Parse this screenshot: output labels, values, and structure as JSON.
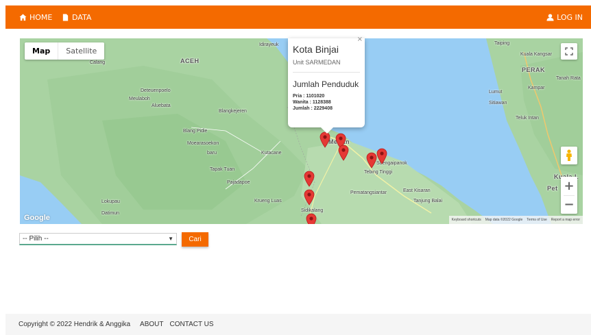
{
  "navbar": {
    "color": "#f46a00",
    "home_label": "HOME",
    "data_label": "DATA",
    "login_label": "LOG IN",
    "home_icon": "home-icon",
    "data_icon": "file-icon",
    "login_icon": "user-icon"
  },
  "map": {
    "type_map": "Map",
    "type_satellite": "Satellite",
    "google_logo": "Google",
    "attribution": {
      "shortcuts": "Keyboard shortcuts",
      "data": "Map data ©2022 Google",
      "terms": "Terms of Use",
      "report": "Report a map error"
    },
    "zoom_in": "+",
    "zoom_out": "−",
    "labels": {
      "idirayeuk": "Idirayeuk",
      "calang": "Calang",
      "aceh": "ACEH",
      "deteuenpoelo": "Deteuenpoelo",
      "meulaboh": "Meulaboh",
      "aluebata": "Aluebata",
      "blangkejeren": "Blangkejeren",
      "blang_pidie": "Blang Pidie",
      "moearasoekon": "Moearasoekon",
      "baru": "baru",
      "kutacane": "Kutacane",
      "tapak_tuan": "Tapak Tuan",
      "pajadapoe": "Pajadapoe",
      "krueng_luas": "Krueng Luas",
      "lokupau": "Lokupau",
      "datimun": "Datimun",
      "medan": "Medan",
      "tebing_tinggi": "Tebing Tinggi",
      "soengaipanok": "Soengaipanok",
      "pematangsiantar": "Pematangsiantar",
      "east_kisaran": "East Kisaran",
      "tanjung_balai": "Tanjung Balai",
      "sidikalang": "Sidikalang",
      "taiping": "Taiping",
      "kuala_kangsar": "Kuala Kangsar",
      "perak": "PERAK",
      "tanah_rata": "Tanah Rata",
      "kampar": "Kampar",
      "lumut": "Lumut",
      "sitiawan": "Sitiawan",
      "teluk_intan": "Teluk Intan",
      "kuala": "Kuala L",
      "pet": "Pet"
    }
  },
  "infowindow": {
    "title": "Kota Binjai",
    "unit": "Unit SARMEDAN",
    "heading": "Jumlah Penduduk",
    "pria": "Pria : 1101020",
    "wanita": "Wanita : 1128388",
    "jumlah": "Jumlah : 2229408",
    "close": "×"
  },
  "form": {
    "select_value": "-- Pilih --",
    "button_label": "Cari"
  },
  "footer": {
    "copyright": "Copyright © 2022 Hendrik & Anggika",
    "about": "ABOUT",
    "contact": "CONTACT US"
  }
}
